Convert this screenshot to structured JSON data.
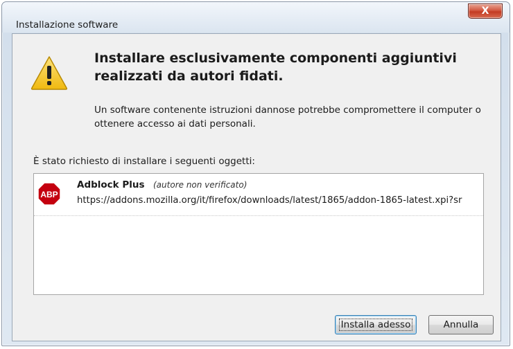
{
  "window": {
    "title": "Installazione software",
    "close_label": "X"
  },
  "dialog": {
    "heading": "Installare esclusivamente componenti aggiuntivi realizzati da autori fidati.",
    "description": "Un software contenente istruzioni dannose potrebbe compromettere il computer o ottenere accesso ai dati personali.",
    "list_label": "È stato richiesto di installare i seguenti oggetti:",
    "items": [
      {
        "icon": "abp-icon",
        "icon_text": "ABP",
        "name": "Adblock Plus",
        "author_note": "(autore non verificato)",
        "url": "https://addons.mozilla.org/it/firefox/downloads/latest/1865/addon-1865-latest.xpi?sr"
      }
    ]
  },
  "buttons": {
    "install_label": "Installa adesso",
    "cancel_label": "Annulla"
  },
  "colors": {
    "close_button": "#c33a22",
    "warning_icon": "#f2c21b",
    "abp_icon": "#c4000f"
  }
}
